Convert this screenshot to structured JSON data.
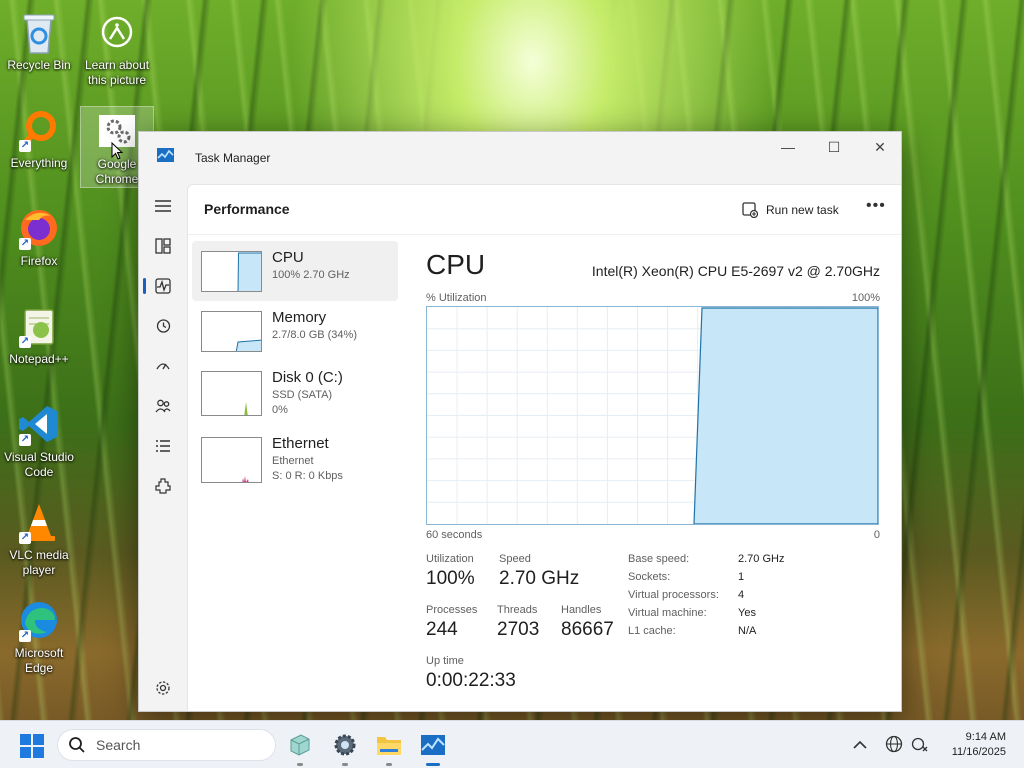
{
  "desktop": {
    "icons": [
      {
        "label": "Recycle Bin"
      },
      {
        "label": "Learn about this picture"
      },
      {
        "label": "Everything"
      },
      {
        "label": "Google Chrome"
      },
      {
        "label": "Firefox"
      },
      {
        "label": "Notepad++"
      },
      {
        "label": "Visual Studio Code"
      },
      {
        "label": "VLC media player"
      },
      {
        "label": "Microsoft Edge"
      }
    ]
  },
  "window": {
    "title": "Task Manager",
    "page_title": "Performance",
    "run_new_task": "Run new task",
    "more": "•••",
    "minimize": "—",
    "maximize": "☐",
    "close": "✕"
  },
  "nav": {
    "items": [
      {
        "icon": "hamburger-icon"
      },
      {
        "icon": "processes-icon"
      },
      {
        "icon": "performance-icon"
      },
      {
        "icon": "app-history-icon"
      },
      {
        "icon": "startup-apps-icon"
      },
      {
        "icon": "users-icon"
      },
      {
        "icon": "details-icon"
      },
      {
        "icon": "services-icon"
      },
      {
        "icon": "settings-icon"
      }
    ]
  },
  "resources": [
    {
      "name": "CPU",
      "sub1": "100% 2.70 GHz",
      "sub2": "",
      "level": 1.0
    },
    {
      "name": "Memory",
      "sub1": "2.7/8.0 GB (34%)",
      "sub2": "",
      "level": 0.34
    },
    {
      "name": "Disk 0 (C:)",
      "sub1": "SSD (SATA)",
      "sub2": "0%",
      "level": 0.0
    },
    {
      "name": "Ethernet",
      "sub1": "Ethernet",
      "sub2": "S: 0 R: 0 Kbps",
      "level": 0.0
    }
  ],
  "cpu": {
    "title": "CPU",
    "model": "Intel(R) Xeon(R) CPU E5-2697 v2 @ 2.70GHz",
    "util_label": "% Utilization",
    "max_label": "100%",
    "time_label": "60 seconds",
    "min_label": "0",
    "accent_fill": "#c7e6f8",
    "accent_line": "#1f73a8",
    "stats": {
      "utilization_label": "Utilization",
      "utilization": "100%",
      "speed_label": "Speed",
      "speed": "2.70 GHz",
      "processes_label": "Processes",
      "processes": "244",
      "threads_label": "Threads",
      "threads": "2703",
      "handles_label": "Handles",
      "handles": "86667",
      "uptime_label": "Up time",
      "uptime": "0:00:22:33"
    },
    "specs": [
      {
        "label": "Base speed:",
        "value": "2.70 GHz"
      },
      {
        "label": "Sockets:",
        "value": "1"
      },
      {
        "label": "Virtual processors:",
        "value": "4"
      },
      {
        "label": "Virtual machine:",
        "value": "Yes"
      },
      {
        "label": "L1 cache:",
        "value": "N/A"
      }
    ]
  },
  "taskbar": {
    "search_placeholder": "Search",
    "time": "9:14 AM",
    "date": "11/16/2025"
  }
}
